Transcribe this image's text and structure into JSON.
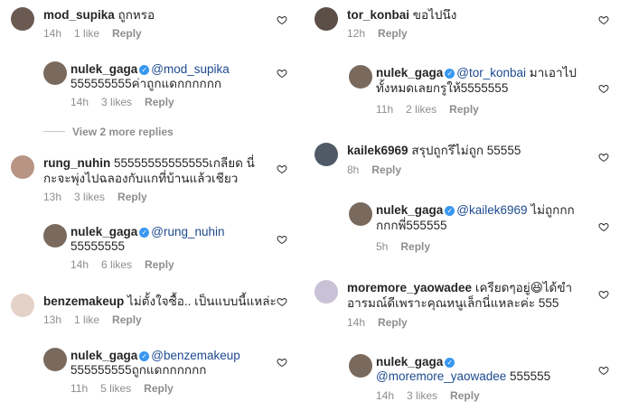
{
  "left": {
    "c1": {
      "user": "mod_supika",
      "text": "ถูกหรอ",
      "time": "14h",
      "likes": "1 like",
      "reply": "Reply"
    },
    "r1": {
      "user": "nulek_gaga",
      "mention": "@mod_supika",
      "text": "555555555ค่าถูกแดกกกกกก",
      "time": "14h",
      "likes": "3 likes",
      "reply": "Reply"
    },
    "view_more": "View 2 more replies",
    "c2": {
      "user": "rung_nuhin",
      "text1": "55555555555555เกลียด นี่",
      "text2": "กะจะพุ่งไปฉลองกับแกที่บ้านแล้วเชียว",
      "time": "13h",
      "likes": "3 likes",
      "reply": "Reply"
    },
    "r2": {
      "user": "nulek_gaga",
      "mention": "@rung_nuhin",
      "text": "55555555",
      "time": "14h",
      "likes": "6 likes",
      "reply": "Reply"
    },
    "c3": {
      "user": "benzemakeup",
      "text": "ไม่ตั้งใจซื้อ.. เป็นแบบนี้แหล่ะ",
      "time": "13h",
      "likes": "1 like",
      "reply": "Reply"
    },
    "r3": {
      "user": "nulek_gaga",
      "mention": "@benzemakeup",
      "text": "555555555ถูกแดกกกกกก",
      "time": "11h",
      "likes": "5 likes",
      "reply": "Reply"
    }
  },
  "right": {
    "c1": {
      "user": "tor_konbai",
      "text": "ขอไปนึง",
      "time": "12h",
      "reply": "Reply"
    },
    "r1": {
      "user": "nulek_gaga",
      "mention": "@tor_konbai",
      "text1": "มาเอาไป",
      "text2": "ทั้งหมดเลยกรูให้5555555",
      "time": "11h",
      "likes": "2 likes",
      "reply": "Reply"
    },
    "c2": {
      "user": "kailek6969",
      "text": "สรุปถูกรึไม่ถูก 55555",
      "time": "8h",
      "reply": "Reply"
    },
    "r2": {
      "user": "nulek_gaga",
      "mention": "@kailek6969",
      "text1": "ไม่ถูกกก",
      "text2": "กกกพี่555555",
      "time": "5h",
      "reply": "Reply"
    },
    "c3": {
      "user": "moremore_yaowadee",
      "text1": "เครียดๆอยู่",
      "emoji": "😆",
      "text1b": "ได้ขำ",
      "text2": "อารมณ์ดีเพราะคุณหนูเล็กนี่แหละค่ะ 555",
      "time": "14h",
      "reply": "Reply"
    },
    "r3": {
      "user": "nulek_gaga",
      "mention": "@moremore_yaowadee",
      "text": "555555",
      "time": "14h",
      "likes": "3 likes",
      "reply": "Reply"
    }
  },
  "icons": {
    "heart": "heart-outline-icon",
    "verified": "verified-badge-icon"
  },
  "colors": {
    "meta": "#8e8e8e",
    "mention": "#1d4a8f",
    "verified": "#3897f0"
  }
}
